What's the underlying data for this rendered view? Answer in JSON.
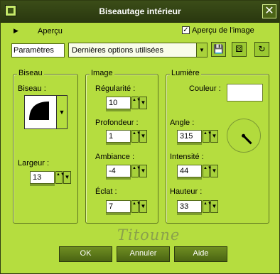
{
  "window": {
    "title": "Biseautage intérieur",
    "close_glyph": "✕",
    "signature": "Titoune"
  },
  "preview": {
    "toggle_glyph": "▶",
    "label": "Aperçu",
    "image_preview_label": "Aperçu de l'image",
    "image_preview_checked": true,
    "check_glyph": "✓"
  },
  "presets": {
    "label": "Paramètres",
    "value": "Dernières options utilisées",
    "arrow": "▼",
    "tools": [
      {
        "icon": "save-icon",
        "glyph": "💾"
      },
      {
        "icon": "dice-icon",
        "glyph": "⚄"
      },
      {
        "icon": "reset-icon",
        "glyph": "↻"
      }
    ]
  },
  "bevel_group": {
    "title": "Biseau",
    "bevel_label": "Biseau :",
    "width_label": "Largeur :",
    "width_value": "13",
    "drop_arrow": "▼"
  },
  "image_group": {
    "title": "Image",
    "smoothness_label": "Régularité :",
    "smoothness_value": "10",
    "depth_label": "Profondeur :",
    "depth_value": "1",
    "ambience_label": "Ambiance :",
    "ambience_value": "-4",
    "shininess_label": "Éclat :",
    "shininess_value": "7"
  },
  "light_group": {
    "title": "Lumière",
    "color_label": "Couleur :",
    "light_color": "#ffffff",
    "angle_label": "Angle :",
    "angle_value": "315",
    "intensity_label": "Intensité :",
    "intensity_value": "44",
    "elevation_label": "Hauteur :",
    "elevation_value": "33"
  },
  "spin_glyphs": {
    "updown": "▲▼",
    "drop": "▼"
  },
  "buttons": {
    "ok": "OK",
    "cancel": "Annuler",
    "help": "Aide"
  },
  "colors": {
    "accent": "#b5dd3f",
    "titlebar": "#2f3c10",
    "button": "#5b7a1a"
  }
}
